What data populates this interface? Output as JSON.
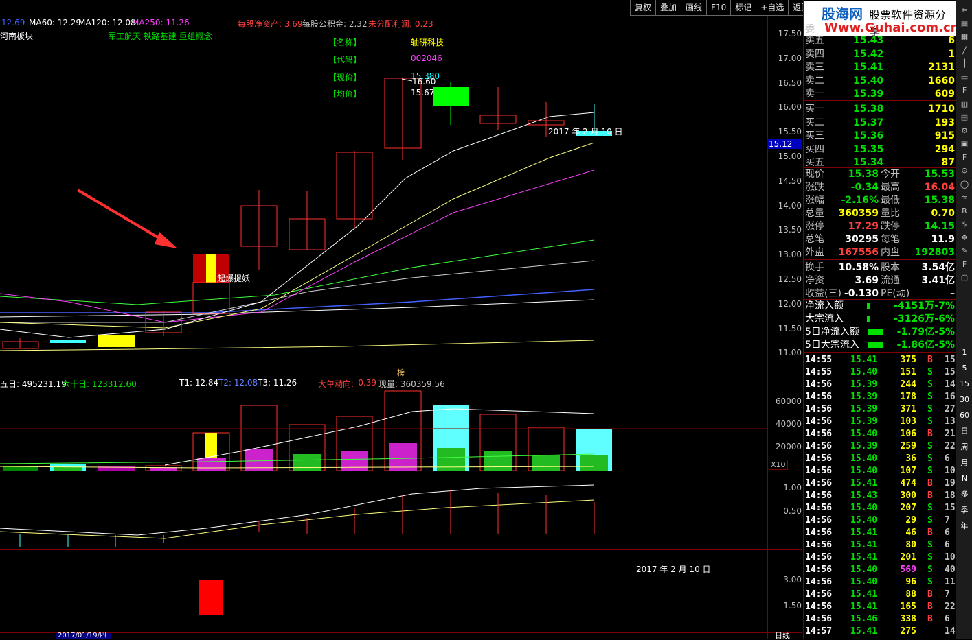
{
  "toolbar": [
    "复权",
    "叠加",
    "画线",
    "F10",
    "标记",
    "+自选",
    "返回"
  ],
  "ma_labels": [
    {
      "text": "12.69",
      "color": "#4060ff"
    },
    {
      "text": "MA60: 12.29",
      "color": "#ffffff"
    },
    {
      "text": "MA120: 12.08",
      "color": "#ffffff"
    },
    {
      "text": "MA250: 11.26",
      "color": "#ff40ff"
    }
  ],
  "fundamentals": {
    "nav": "每股净资产: 3.69",
    "capfund": "每股公积金: 2.32",
    "undist": "未分配利润: 0.23"
  },
  "sector": {
    "left": "河南板块",
    "concepts": "军工航天 铁路基建 重组概念"
  },
  "stock_info": {
    "name_label": "【名称】",
    "name": "轴研科技",
    "code_label": "【代码】",
    "code": "002046",
    "price_label": "【现价】",
    "price": "15.380",
    "avg_label": "【均价】",
    "avg": "15.67"
  },
  "annotations": {
    "high": "16.60",
    "signal": "起爆捉妖",
    "date_main": "2017 年 2 月 10 日",
    "date_lower": "2017 年 2 月 10 日",
    "bottom_date": "2017/01/19/四",
    "bang": "榜",
    "x10": "X10",
    "day_line": "日线",
    "price_tag": "15.12"
  },
  "price_ticks": [
    "17.50",
    "17.00",
    "16.50",
    "16.00",
    "15.50",
    "15.00",
    "14.50",
    "14.00",
    "13.50",
    "13.00",
    "12.50",
    "12.00",
    "11.50",
    "11.00"
  ],
  "vol_header": {
    "wuri": "五日: 495231.19",
    "liushi": "六十日: 123312.60",
    "t1": "T1: 12.84",
    "t2": "T2: 12.08",
    "t3": "T3: 11.26",
    "dadan_label": "大单动向:",
    "dadan_val": "-0.39",
    "xianliang": "现量: 360359.56"
  },
  "vol_ticks": [
    "60000",
    "40000",
    "20000"
  ],
  "ind_ticks": [
    "1.00",
    "0.50"
  ],
  "ind2_ticks": [
    "3.00",
    "1.50"
  ],
  "order_book": [
    {
      "label": "卖五",
      "price": "15.43",
      "vol": "6"
    },
    {
      "label": "卖四",
      "price": "15.42",
      "vol": "1"
    },
    {
      "label": "卖三",
      "price": "15.41",
      "vol": "2131"
    },
    {
      "label": "卖二",
      "price": "15.40",
      "vol": "1660"
    },
    {
      "label": "卖一",
      "price": "15.39",
      "vol": "609"
    },
    {
      "label": "买一",
      "price": "15.38",
      "vol": "1710"
    },
    {
      "label": "买二",
      "price": "15.37",
      "vol": "193"
    },
    {
      "label": "买三",
      "price": "15.36",
      "vol": "915"
    },
    {
      "label": "买四",
      "price": "15.35",
      "vol": "294"
    },
    {
      "label": "买五",
      "price": "15.34",
      "vol": "87"
    }
  ],
  "wei_label": "委",
  "stats": [
    {
      "l1": "现价",
      "v1": "15.38",
      "c1": "#00e000",
      "l2": "今开",
      "v2": "15.53",
      "c2": "#00e000"
    },
    {
      "l1": "涨跌",
      "v1": "-0.34",
      "c1": "#00e000",
      "l2": "最高",
      "v2": "16.04",
      "c2": "#ff4040"
    },
    {
      "l1": "涨幅",
      "v1": "-2.16%",
      "c1": "#00e000",
      "l2": "最低",
      "v2": "15.38",
      "c2": "#00e000"
    },
    {
      "l1": "总量",
      "v1": "360359",
      "c1": "#ffff00",
      "l2": "量比",
      "v2": "0.70",
      "c2": "#ffff00"
    },
    {
      "l1": "涨停",
      "v1": "17.29",
      "c1": "#ff4040",
      "l2": "跌停",
      "v2": "14.15",
      "c2": "#00e000"
    },
    {
      "l1": "总笔",
      "v1": "30295",
      "c1": "#ffffff",
      "l2": "每笔",
      "v2": "11.9",
      "c2": "#ffffff"
    },
    {
      "l1": "外盘",
      "v1": "167556",
      "c1": "#ff4040",
      "l2": "内盘",
      "v2": "192803",
      "c2": "#00e000"
    },
    {
      "l1": "换手",
      "v1": "10.58%",
      "c1": "#ffffff",
      "l2": "股本",
      "v2": "3.54亿",
      "c2": "#ffffff"
    },
    {
      "l1": "净资",
      "v1": "3.69",
      "c1": "#ffffff",
      "l2": "流通",
      "v2": "3.41亿",
      "c2": "#ffffff"
    },
    {
      "l1": "收益(三)",
      "v1": "-0.130",
      "c1": "#ffffff",
      "l2": "PE(动)",
      "v2": "–",
      "c2": "#ffffff"
    }
  ],
  "flows": [
    {
      "label": "净流入额",
      "val": "-4151万",
      "pct": "-7%"
    },
    {
      "label": "大宗流入",
      "val": "-3126万",
      "pct": "-6%"
    },
    {
      "label": "5日净流入额",
      "val": "-1.79亿",
      "pct": "-5%"
    },
    {
      "label": "5日大宗流入",
      "val": "-1.86亿",
      "pct": "-5%"
    }
  ],
  "ticks": [
    {
      "t": "14:55",
      "p": "15.41",
      "v": "375",
      "d": "B",
      "n": "15"
    },
    {
      "t": "14:55",
      "p": "15.40",
      "v": "151",
      "d": "S",
      "n": "15"
    },
    {
      "t": "14:56",
      "p": "15.39",
      "v": "244",
      "d": "S",
      "n": "14"
    },
    {
      "t": "14:56",
      "p": "15.39",
      "v": "178",
      "d": "S",
      "n": "16"
    },
    {
      "t": "14:56",
      "p": "15.39",
      "v": "371",
      "d": "S",
      "n": "27"
    },
    {
      "t": "14:56",
      "p": "15.39",
      "v": "103",
      "d": "S",
      "n": "13"
    },
    {
      "t": "14:56",
      "p": "15.40",
      "v": "106",
      "d": "B",
      "n": "21"
    },
    {
      "t": "14:56",
      "p": "15.39",
      "v": "259",
      "d": "S",
      "n": "22"
    },
    {
      "t": "14:56",
      "p": "15.40",
      "v": "36",
      "d": "S",
      "n": "6"
    },
    {
      "t": "14:56",
      "p": "15.40",
      "v": "107",
      "d": "S",
      "n": "10"
    },
    {
      "t": "14:56",
      "p": "15.41",
      "v": "474",
      "d": "B",
      "n": "19"
    },
    {
      "t": "14:56",
      "p": "15.43",
      "v": "300",
      "d": "B",
      "n": "18"
    },
    {
      "t": "14:56",
      "p": "15.40",
      "v": "207",
      "d": "S",
      "n": "15"
    },
    {
      "t": "14:56",
      "p": "15.40",
      "v": "29",
      "d": "S",
      "n": "7"
    },
    {
      "t": "14:56",
      "p": "15.41",
      "v": "46",
      "d": "B",
      "n": "6"
    },
    {
      "t": "14:56",
      "p": "15.41",
      "v": "80",
      "d": "S",
      "n": "6"
    },
    {
      "t": "14:56",
      "p": "15.41",
      "v": "201",
      "d": "S",
      "n": "10"
    },
    {
      "t": "14:56",
      "p": "15.40",
      "v": "569",
      "d": "S",
      "n": "40"
    },
    {
      "t": "14:56",
      "p": "15.40",
      "v": "96",
      "d": "S",
      "n": "11"
    },
    {
      "t": "14:56",
      "p": "15.41",
      "v": "88",
      "d": "B",
      "n": "7"
    },
    {
      "t": "14:56",
      "p": "15.41",
      "v": "165",
      "d": "B",
      "n": "22"
    },
    {
      "t": "14:56",
      "p": "15.46",
      "v": "338",
      "d": "B",
      "n": "6"
    },
    {
      "t": "14:57",
      "p": "15.41",
      "v": "275",
      "d": "",
      "n": "14"
    }
  ],
  "logo": {
    "brand": "股海网",
    "slogan": "股票软件资源分享",
    "url": "Www.Guhai.com.cn"
  },
  "side_icons": [
    "1",
    "5",
    "15",
    "30",
    "60",
    "日",
    "周",
    "月",
    "N",
    "多",
    "季",
    "年"
  ]
}
